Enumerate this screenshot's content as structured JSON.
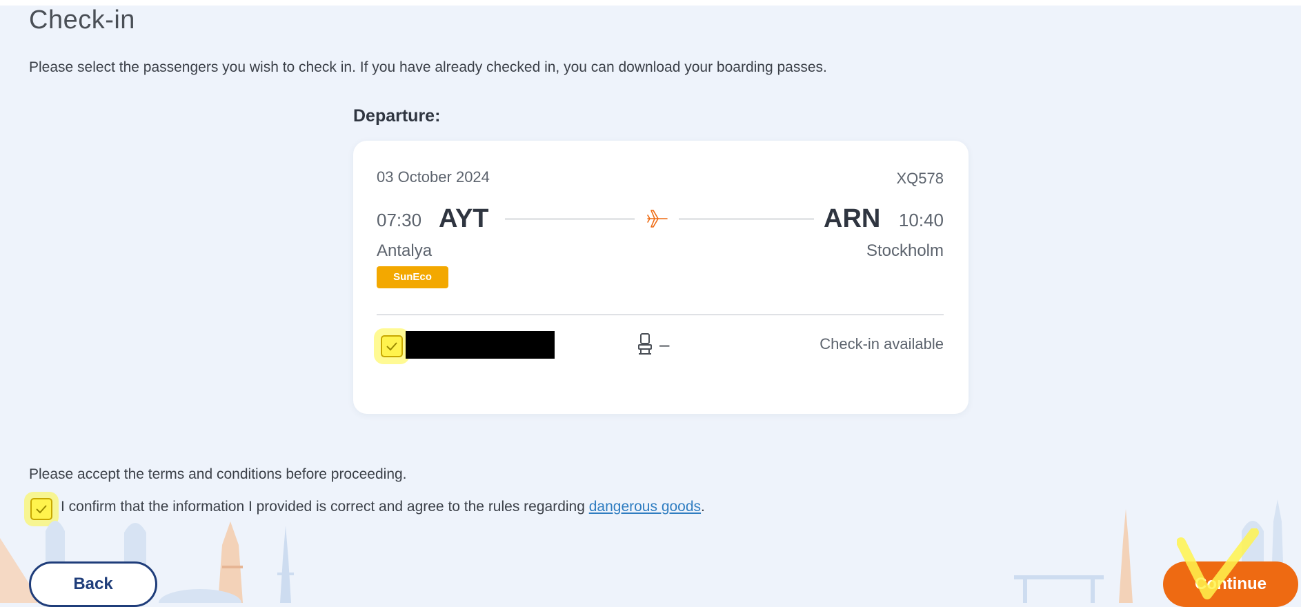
{
  "page": {
    "title": "Check-in",
    "instructions": "Please select the passengers you wish to check in. If you have already checked in, you can download your boarding passes."
  },
  "departure": {
    "label": "Departure:",
    "date": "03 October 2024",
    "flight_number": "XQ578",
    "origin": {
      "time": "07:30",
      "code": "AYT",
      "city": "Antalya"
    },
    "destination": {
      "time": "10:40",
      "code": "ARN",
      "city": "Stockholm"
    },
    "fare_class": "SunEco",
    "passenger": {
      "selected": true,
      "seat": "–",
      "status": "Check-in available"
    }
  },
  "terms": {
    "prompt": "Please accept the terms and conditions before proceeding.",
    "confirm_text": "I confirm that the information I provided is correct and agree to the rules regarding ",
    "link_text": "dangerous goods",
    "confirm_suffix": ".",
    "accepted": true
  },
  "buttons": {
    "back_label": "Back",
    "continue_label": "Continue"
  },
  "colors": {
    "accent_orange": "#ee6a12",
    "fare_badge": "#f3a800",
    "navy": "#1f3d7a",
    "link": "#2f7dc1",
    "highlight": "#fff34d"
  },
  "icons": {
    "plane": "plane-icon",
    "seat": "seat-icon",
    "check": "checkmark-icon"
  }
}
